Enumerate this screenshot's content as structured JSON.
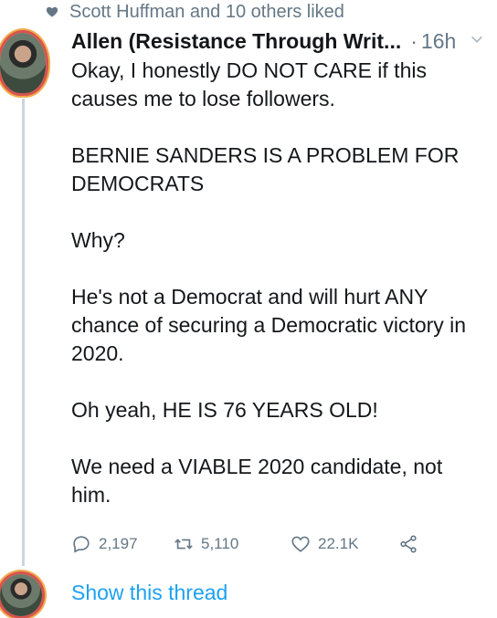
{
  "social_context": {
    "text": "Scott Huffman and 10 others liked"
  },
  "tweet": {
    "author": "Allen (Resistance Through Writ...",
    "separator": "·",
    "time": "16h",
    "paragraphs": [
      "Okay, I honestly DO NOT CARE if this causes me to lose followers.",
      "BERNIE SANDERS IS A PROBLEM FOR DEMOCRATS",
      "Why?",
      "He's not a Democrat and will hurt ANY chance of securing a Democratic victory in 2020.",
      "Oh yeah, HE IS 76 YEARS OLD!",
      "We need a VIABLE 2020 candidate, not him."
    ],
    "actions": {
      "replies": "2,197",
      "retweets": "5,110",
      "likes": "22.1K"
    }
  },
  "thread": {
    "show_label": "Show this thread"
  },
  "icons": {
    "heart": "heart-icon",
    "reply": "reply-icon",
    "retweet": "retweet-icon",
    "like": "like-icon",
    "share": "share-icon",
    "more": "chevron-down-icon"
  },
  "colors": {
    "link": "#1da1f2",
    "muted": "#657786",
    "line": "#ccd6dd"
  }
}
